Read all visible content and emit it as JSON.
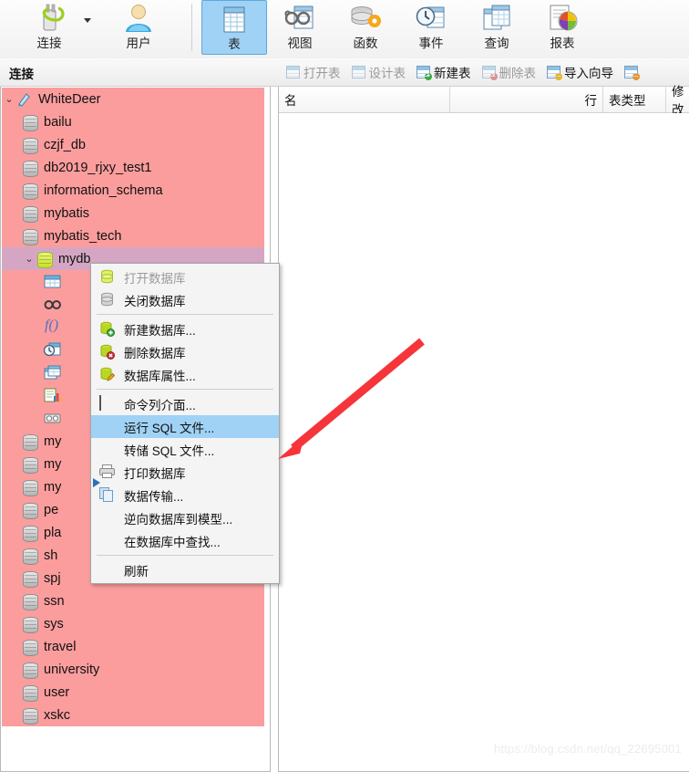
{
  "ribbon": {
    "buttons": [
      {
        "label": "连接",
        "icon": "connection-icon",
        "selected": false,
        "has_dropdown": true
      },
      {
        "label": "用户",
        "icon": "user-icon",
        "selected": false,
        "has_dropdown": false
      },
      {
        "label": "表",
        "icon": "table-icon",
        "selected": true,
        "has_dropdown": false
      },
      {
        "label": "视图",
        "icon": "view-icon",
        "selected": false,
        "has_dropdown": false
      },
      {
        "label": "函数",
        "icon": "function-icon",
        "selected": false,
        "has_dropdown": false
      },
      {
        "label": "事件",
        "icon": "event-icon",
        "selected": false,
        "has_dropdown": false
      },
      {
        "label": "查询",
        "icon": "query-icon",
        "selected": false,
        "has_dropdown": false
      },
      {
        "label": "报表",
        "icon": "report-icon",
        "selected": false,
        "has_dropdown": false
      }
    ]
  },
  "toolbar2": {
    "pane_title": "连接",
    "items": [
      {
        "label": "打开表",
        "icon": "open-table-icon",
        "enabled": false
      },
      {
        "label": "设计表",
        "icon": "design-table-icon",
        "enabled": false
      },
      {
        "label": "新建表",
        "icon": "new-table-icon",
        "enabled": true
      },
      {
        "label": "删除表",
        "icon": "delete-table-icon",
        "enabled": false
      },
      {
        "label": "导入向导",
        "icon": "import-wizard-icon",
        "enabled": true
      },
      {
        "label": "",
        "icon": "export-wizard-icon",
        "enabled": true
      }
    ]
  },
  "tree": {
    "root": {
      "label": "WhiteDeer",
      "icon": "connection-icon",
      "expanded": true
    },
    "databases": [
      {
        "label": "bailu",
        "state": "closed"
      },
      {
        "label": "czjf_db",
        "state": "closed"
      },
      {
        "label": "db2019_rjxy_test1",
        "state": "closed"
      },
      {
        "label": "information_schema",
        "state": "closed"
      },
      {
        "label": "mybatis",
        "state": "closed"
      },
      {
        "label": "mybatis_tech",
        "state": "closed"
      },
      {
        "label": "mydb",
        "state": "open",
        "selected": true,
        "expanded": true
      }
    ],
    "mydb_children": [
      {
        "label": "",
        "icon": "tables-folder-icon"
      },
      {
        "label": "",
        "icon": "views-folder-icon"
      },
      {
        "label": "",
        "icon": "functions-folder-icon"
      },
      {
        "label": "",
        "icon": "events-folder-icon"
      },
      {
        "label": "",
        "icon": "queries-folder-icon"
      },
      {
        "label": "",
        "icon": "reports-folder-icon"
      },
      {
        "label": "",
        "icon": "backups-folder-icon"
      }
    ],
    "databases_after": [
      {
        "label": "my",
        "state": "closed",
        "truncated": true
      },
      {
        "label": "my",
        "state": "closed",
        "truncated": true
      },
      {
        "label": "my",
        "state": "closed",
        "truncated": true
      },
      {
        "label": "pe",
        "state": "closed",
        "truncated": true
      },
      {
        "label": "pla",
        "state": "closed",
        "truncated": true
      },
      {
        "label": "sh",
        "state": "closed",
        "truncated": true
      },
      {
        "label": "spj",
        "state": "closed",
        "truncated": true
      },
      {
        "label": "ssn",
        "state": "closed",
        "truncated": true
      },
      {
        "label": "sys",
        "state": "closed"
      },
      {
        "label": "travel",
        "state": "closed"
      },
      {
        "label": "university",
        "state": "closed"
      },
      {
        "label": "user",
        "state": "closed"
      },
      {
        "label": "xskc",
        "state": "closed"
      }
    ]
  },
  "grid": {
    "columns": [
      {
        "label": "名",
        "align": "left"
      },
      {
        "label": "行",
        "align": "right"
      },
      {
        "label": "表类型",
        "align": "left"
      },
      {
        "label": "修改",
        "align": "left"
      }
    ],
    "rows": []
  },
  "context_menu": {
    "items": [
      {
        "label": "打开数据库",
        "icon": "db-open-icon",
        "disabled": true
      },
      {
        "label": "关闭数据库",
        "icon": "db-closed-icon",
        "disabled": false
      },
      {
        "separator": true
      },
      {
        "label": "新建数据库...",
        "icon": "db-add-icon",
        "disabled": false
      },
      {
        "label": "删除数据库",
        "icon": "db-delete-icon",
        "disabled": false
      },
      {
        "label": "数据库属性...",
        "icon": "db-properties-icon",
        "disabled": false
      },
      {
        "separator": true
      },
      {
        "label": "命令列介面...",
        "icon": "console-icon",
        "disabled": false
      },
      {
        "label": "运行 SQL 文件...",
        "icon": "",
        "disabled": false,
        "highlighted": true
      },
      {
        "label": "转储 SQL 文件...",
        "icon": "",
        "disabled": false
      },
      {
        "label": "打印数据库",
        "icon": "printer-icon",
        "disabled": false
      },
      {
        "label": "数据传输...",
        "icon": "transfer-icon",
        "disabled": false
      },
      {
        "label": "逆向数据库到模型...",
        "icon": "",
        "disabled": false
      },
      {
        "label": "在数据库中查找...",
        "icon": "",
        "disabled": false
      },
      {
        "separator": true
      },
      {
        "label": "刷新",
        "icon": "",
        "disabled": false
      }
    ]
  },
  "annotation": {
    "arrow_color": "#f5353a",
    "points_to": "运行 SQL 文件..."
  },
  "watermark": {
    "text": "https://blog.csdn.net/qq_22695001"
  },
  "colors": {
    "tree_pink": "#fb9d9d",
    "selected_row": "#d4a6c4",
    "menu_highlight": "#9fd2f5",
    "ribbon_selected": "#9fd2f5",
    "arrow_red": "#f5353a"
  }
}
